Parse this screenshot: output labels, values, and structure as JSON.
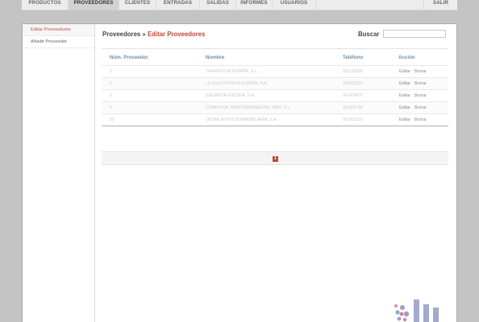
{
  "nav": {
    "items": [
      {
        "label": "PRODUCTOS",
        "active": false
      },
      {
        "label": "PROVEEDORES",
        "active": true
      },
      {
        "label": "CLIENTES",
        "active": false
      },
      {
        "label": "ENTRADAS",
        "active": false
      },
      {
        "label": "SALIDAS",
        "active": false
      },
      {
        "label": "INFORMES",
        "active": false
      },
      {
        "label": "USUARIOS",
        "active": false
      }
    ],
    "logout": "SALIR"
  },
  "sidebar": {
    "items": [
      {
        "label": "Editar Proveedores",
        "active": true
      },
      {
        "label": "Añadir Proveedor",
        "active": false
      }
    ]
  },
  "breadcrumb": {
    "section": "Proveedores",
    "separator": "»",
    "current": "Editar Proveedores"
  },
  "search": {
    "label": "Buscar",
    "value": ""
  },
  "table": {
    "headers": {
      "id": "Núm. Proveedor",
      "name": "Nombre",
      "phone": "Teléfono",
      "action": "Acción"
    },
    "rows": [
      {
        "id": "1",
        "name": "CARREFOUR ESPAÑA, S.L.",
        "phone": "901100200",
        "edit": "Editar",
        "delete": "Borrar"
      },
      {
        "id": "2",
        "name": "LG ELECTRONICS ESPAÑA, S.A.",
        "phone": "902500234",
        "edit": "Editar",
        "delete": "Borrar"
      },
      {
        "id": "3",
        "name": "SALVADOR ESCODA, S.A.",
        "phone": "961476670",
        "edit": "Editar",
        "delete": "Borrar"
      },
      {
        "id": "4",
        "name": "COMERCIAL MEDITERRANEA DEL MAR, S.L.",
        "phone": "961220780",
        "edit": "Editar",
        "delete": "Borrar"
      },
      {
        "id": "55",
        "name": "OFIDIA SERVICIO INMOBILIARIA, S.A.",
        "phone": "961582210",
        "edit": "Editar",
        "delete": "Borrar"
      }
    ]
  },
  "pagination": {
    "current_page": "1"
  },
  "colors": {
    "accent": "#c0473a",
    "header_text": "#6f8fa5",
    "background": "#c4c4c4"
  }
}
